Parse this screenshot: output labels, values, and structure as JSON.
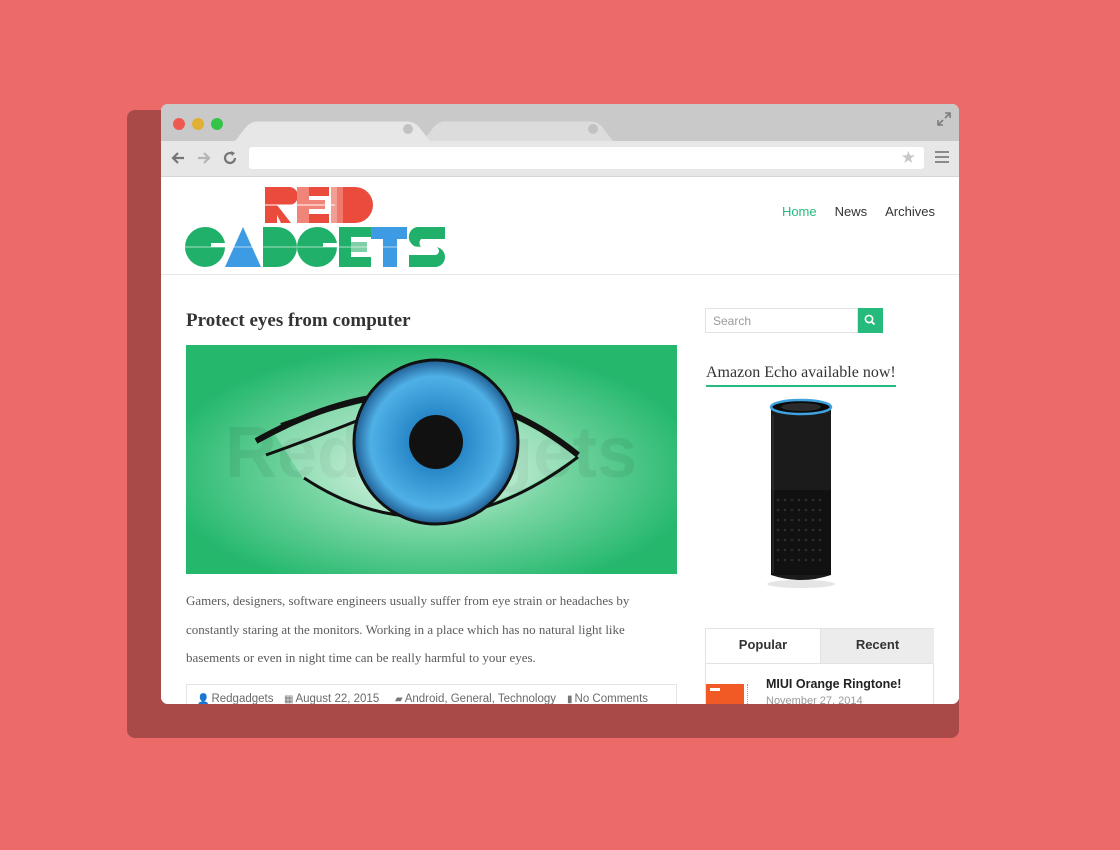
{
  "browser": {
    "tabs": [
      "",
      ""
    ],
    "url": ""
  },
  "site": {
    "logo": {
      "line1": "RED",
      "line2": "GADGETS"
    },
    "nav": [
      {
        "label": "Home",
        "active": true
      },
      {
        "label": "News",
        "active": false
      },
      {
        "label": "Archives",
        "active": false
      }
    ]
  },
  "post": {
    "title": "Protect eyes from computer",
    "image_watermark": "Redgadgets",
    "excerpt": "Gamers, designers, software engineers usually suffer from eye strain or headaches by constantly staring at the monitors. Working in a place which has no natural light like basements or even in night time can be really harmful to your eyes.",
    "meta": {
      "author": "Redgadgets",
      "date": "August 22, 2015",
      "categories": "Android, General, Technology",
      "comments": "No Comments"
    }
  },
  "sidebar": {
    "search_placeholder": "Search",
    "widget_title": "Amazon Echo available now!",
    "tabs": [
      "Popular",
      "Recent"
    ],
    "popular_posts": [
      {
        "title": "MIUI Orange Ringtone!",
        "date": "November 27, 2014"
      }
    ]
  },
  "colors": {
    "background": "#ec6b69",
    "accent": "#26bb7c",
    "logo_red": "#ea4b3c",
    "logo_green": "#21b06a",
    "logo_blue": "#3d9be3"
  }
}
